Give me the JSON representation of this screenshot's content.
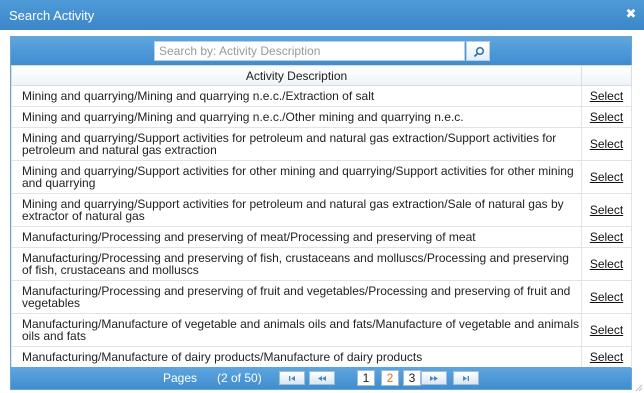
{
  "dialog": {
    "title": "Search Activity",
    "close_glyph": "✖"
  },
  "search": {
    "placeholder": "Search by: Activity Description",
    "value": ""
  },
  "table": {
    "column_header": "Activity Description",
    "select_label": "Select",
    "rows": [
      "Mining and quarrying/Mining and quarrying n.e.c./Extraction of salt",
      "Mining and quarrying/Mining and quarrying n.e.c./Other mining and quarrying n.e.c.",
      "Mining and quarrying/Support activities for petroleum and natural gas extraction/Support activities for petroleum and natural gas extraction",
      "Mining and quarrying/Support activities for other mining and quarrying/Support activities for other mining and quarrying",
      "Mining and quarrying/Support activities for petroleum and natural gas extraction/Sale of natural gas by extractor of natural gas",
      "Manufacturing/Processing and preserving of meat/Processing and preserving of meat",
      "Manufacturing/Processing and preserving of fish, crustaceans and molluscs/Processing and preserving of fish, crustaceans and molluscs",
      "Manufacturing/Processing and preserving of fruit and vegetables/Processing and preserving of fruit and vegetables",
      "Manufacturing/Manufacture of vegetable and animals oils and fats/Manufacture of vegetable and animals oils and fats",
      "Manufacturing/Manufacture of dairy products/Manufacture of dairy products"
    ]
  },
  "pager": {
    "label": "Pages",
    "count": "(2 of 50)",
    "pages": [
      "1",
      "2",
      "3"
    ],
    "current_page": "2"
  },
  "colors": {
    "header_blue": "#3f8ccf",
    "current_page": "#e2721d"
  },
  "icons": {
    "search": "search-icon",
    "close": "close-icon",
    "first": "first-page-icon",
    "prev": "prev-page-icon",
    "next": "next-page-icon",
    "last": "last-page-icon"
  }
}
